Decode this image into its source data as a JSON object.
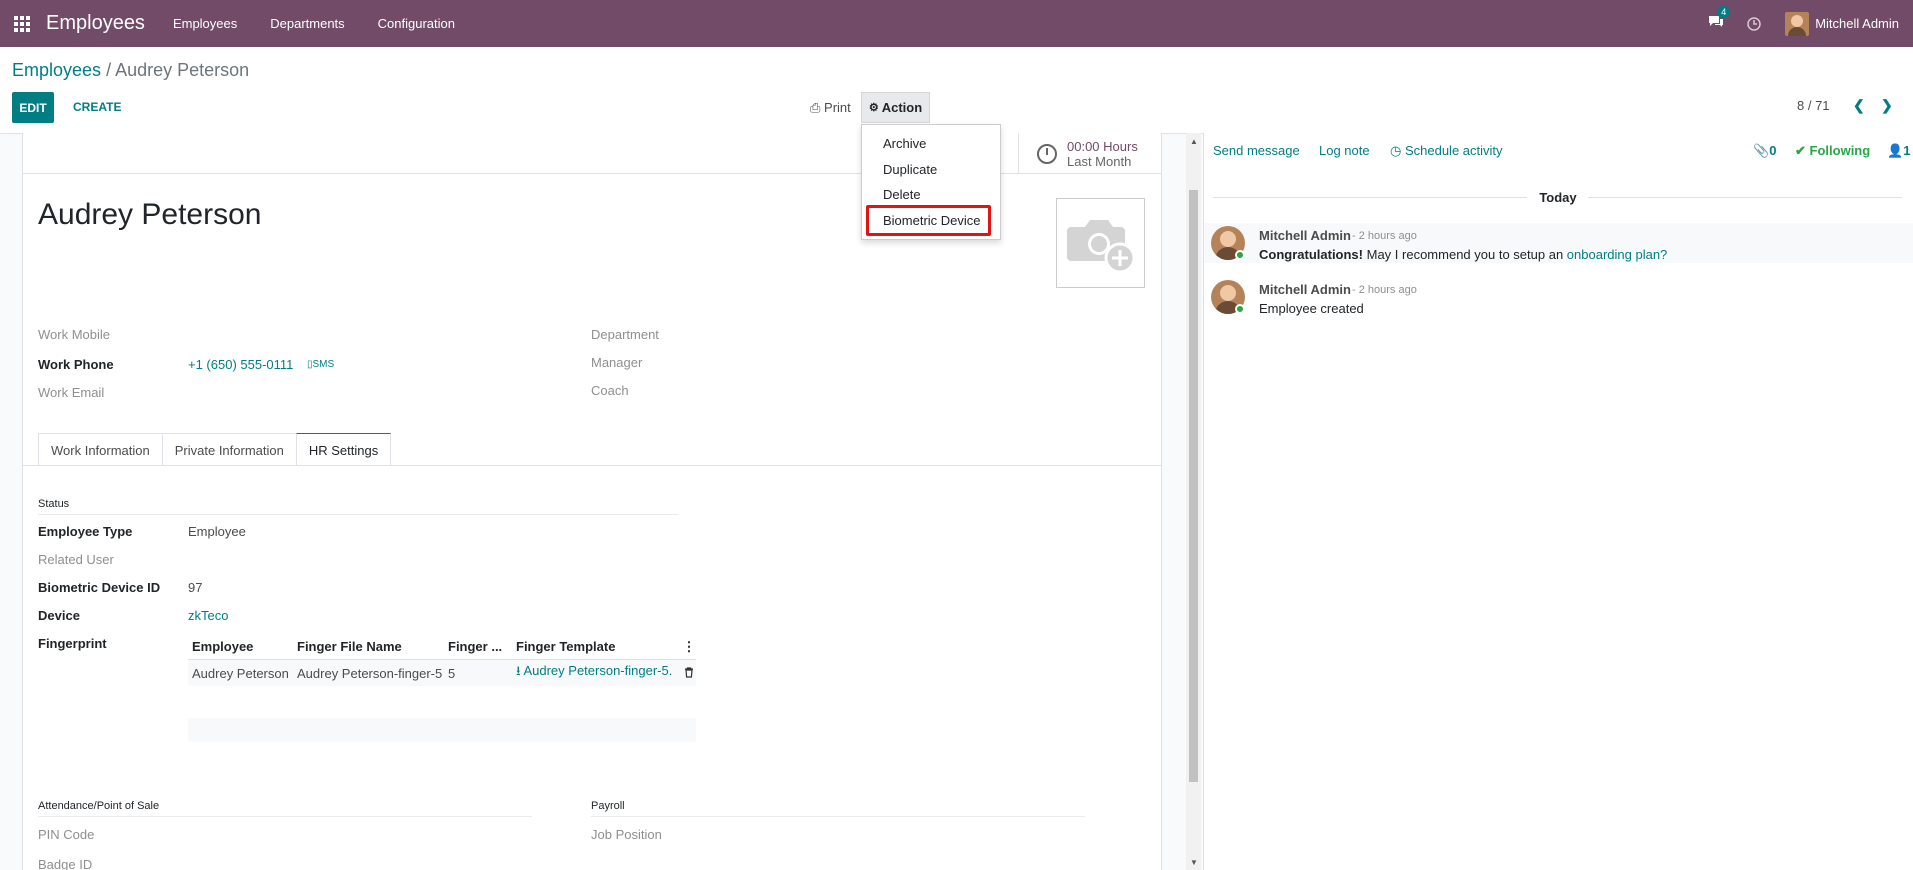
{
  "navbar": {
    "app_name": "Employees",
    "menus": [
      "Employees",
      "Departments",
      "Configuration"
    ],
    "messages_count": "4",
    "user_name": "Mitchell Admin"
  },
  "breadcrumb": {
    "parent": "Employees",
    "separator": "/",
    "current": "Audrey Peterson"
  },
  "toolbar": {
    "edit_label": "EDIT",
    "create_label": "CREATE",
    "print_label": "Print",
    "action_label": "Action",
    "pager": "8 / 71"
  },
  "action_menu": {
    "items": [
      "Archive",
      "Duplicate",
      "Delete",
      "Biometric Device"
    ],
    "highlighted": "Biometric Device"
  },
  "stat_button": {
    "value": "00:00 Hours",
    "label": "Last Month"
  },
  "employee": {
    "name": "Audrey Peterson",
    "work_mobile_label": "Work Mobile",
    "work_phone_label": "Work Phone",
    "work_phone": "+1 (650) 555-0111",
    "sms_label": "SMS",
    "work_email_label": "Work Email",
    "department_label": "Department",
    "manager_label": "Manager",
    "coach_label": "Coach"
  },
  "tabs": [
    "Work Information",
    "Private Information",
    "HR Settings"
  ],
  "active_tab": "HR Settings",
  "hr_settings": {
    "status_title": "Status",
    "employee_type_label": "Employee Type",
    "employee_type": "Employee",
    "related_user_label": "Related User",
    "biometric_id_label": "Biometric Device ID",
    "biometric_id": "97",
    "device_label": "Device",
    "device": "zkTeco",
    "fingerprint_label": "Fingerprint",
    "fingerprint_columns": [
      "Employee",
      "Finger File Name",
      "Finger ...",
      "Finger Template"
    ],
    "fingerprint_rows": [
      [
        "Audrey Peterson",
        "Audrey Peterson-finger-5",
        "5",
        "Audrey Peterson-finger-5."
      ]
    ],
    "attendance_title": "Attendance/Point of Sale",
    "pin_label": "PIN Code",
    "badge_label": "Badge ID",
    "payroll_title": "Payroll",
    "job_position_label": "Job Position"
  },
  "chatter": {
    "send_message": "Send message",
    "log_note": "Log note",
    "schedule_activity": "Schedule activity",
    "attachments_count": "0",
    "following_label": "Following",
    "followers_count": "1",
    "date_separator": "Today",
    "messages": [
      {
        "author": "Mitchell Admin",
        "time": "- 2 hours ago",
        "bold_prefix": "Congratulations!",
        "body": "May I recommend you to setup an",
        "link": "onboarding plan?"
      },
      {
        "author": "Mitchell Admin",
        "time": "- 2 hours ago",
        "body": "Employee created"
      }
    ]
  },
  "colors": {
    "brand": "#714b67",
    "accent": "#017e84",
    "highlight_border": "#e21313",
    "online": "#28a745"
  }
}
